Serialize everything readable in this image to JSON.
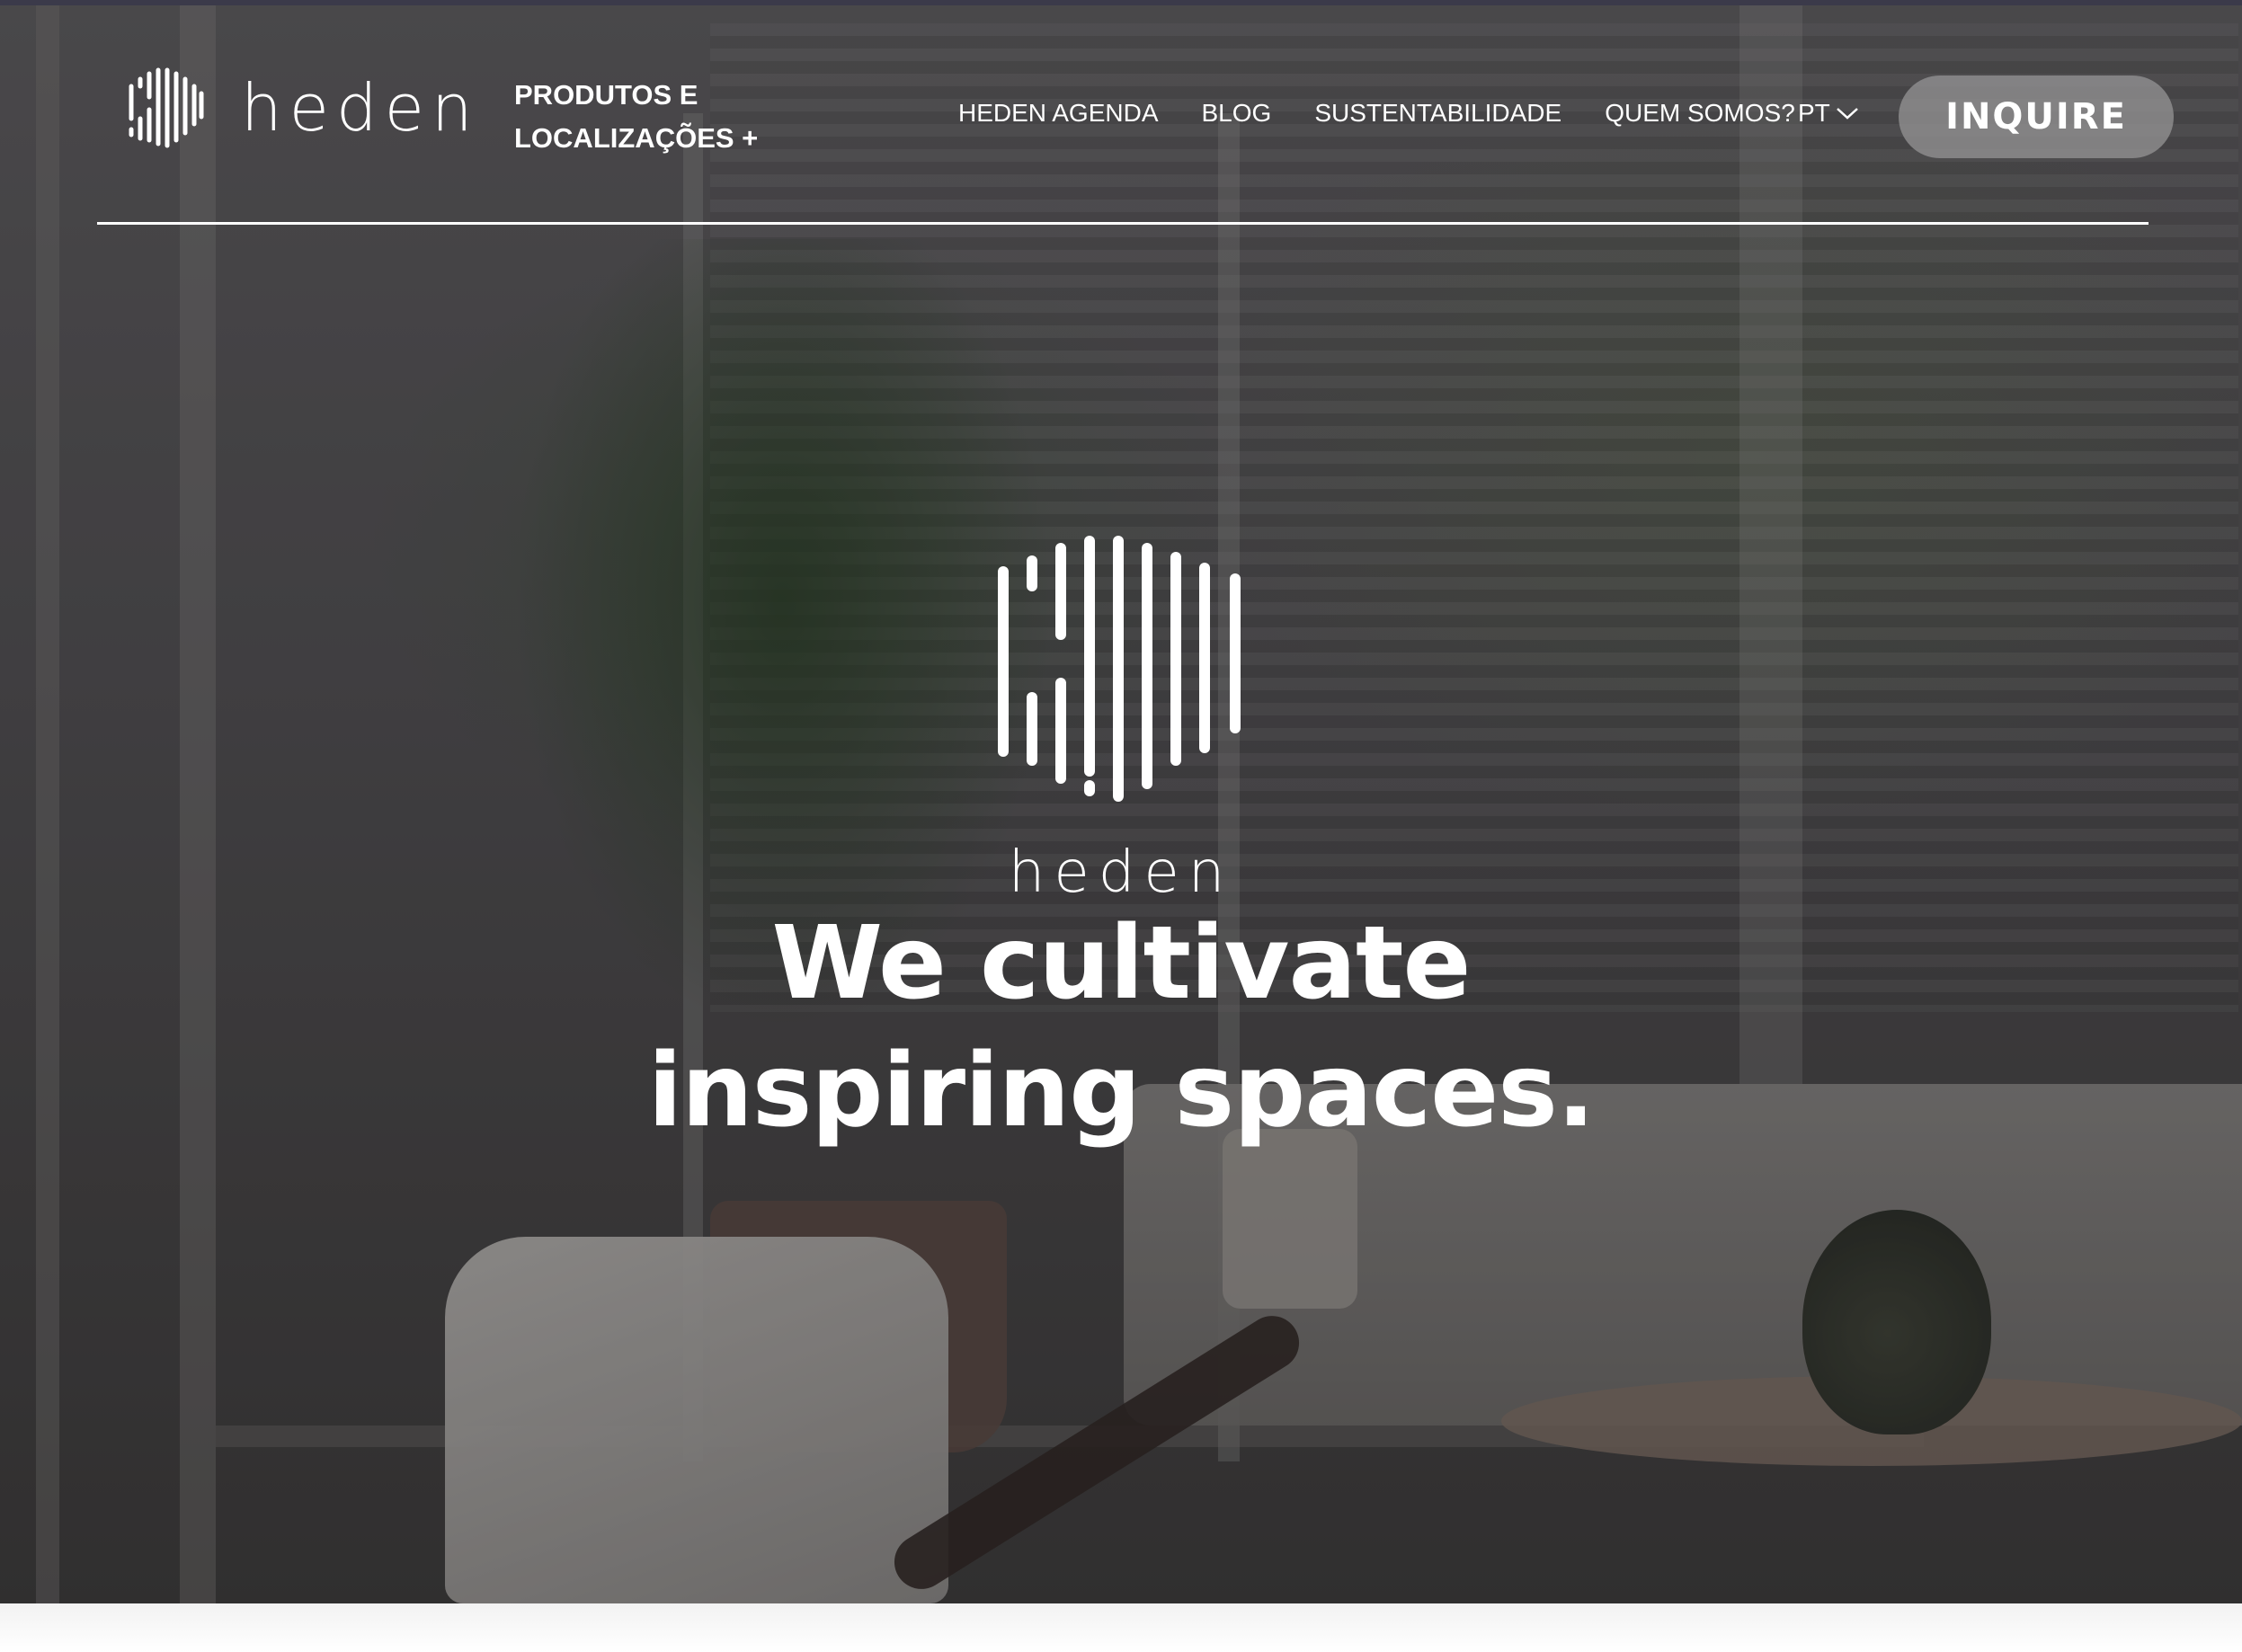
{
  "brand": {
    "name": "heden",
    "logo_icon": "heden-bars-logo-icon"
  },
  "header": {
    "products_menu_line1": "PRODUTOS E",
    "products_menu_line2": "LOCALIZAÇÕES +",
    "nav": [
      {
        "label": "HEDEN AGENDA"
      },
      {
        "label": "BLOG"
      },
      {
        "label": "SUSTENTABILIDADE"
      },
      {
        "label": "QUEM SOMOS?"
      }
    ],
    "language": "PT",
    "language_icon": "chevron-down-icon",
    "inquire_label": "INQUIRE"
  },
  "hero": {
    "logo_word": "heden",
    "headline_line1": "We cultivate",
    "headline_line2": "inspiring spaces."
  },
  "colors": {
    "text": "#ffffff",
    "button_bg": "#969496",
    "top_strip": "#3b3a4a"
  }
}
